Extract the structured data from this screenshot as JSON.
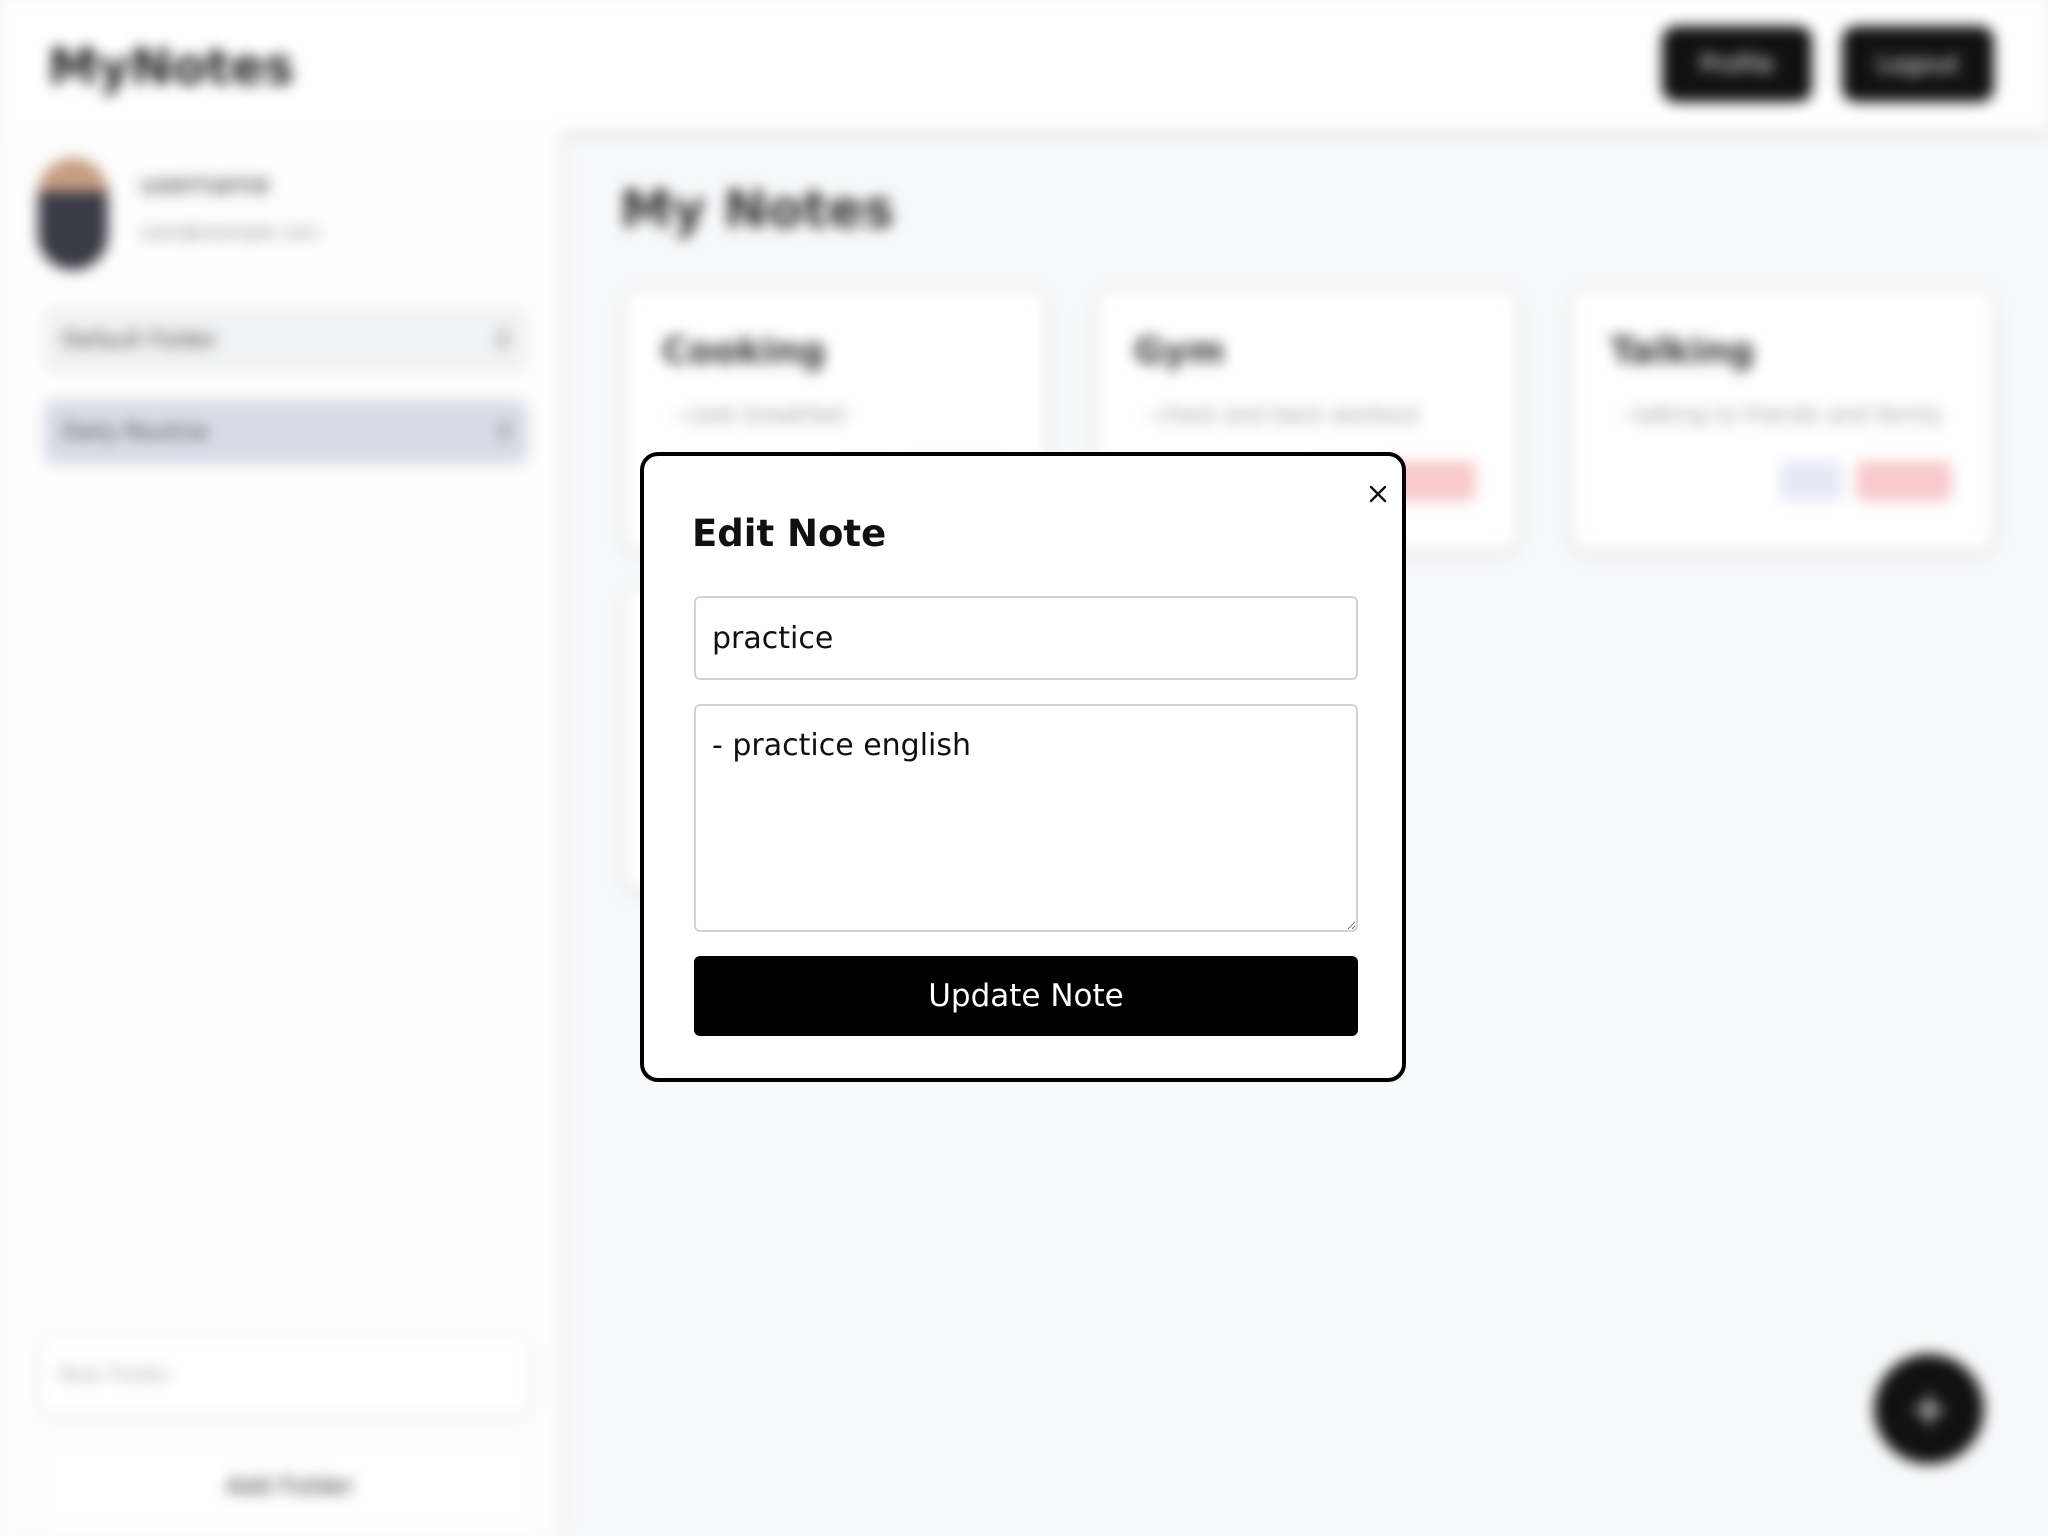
{
  "app": {
    "brand": "MyNotes",
    "header_buttons": [
      "Profile",
      "Logout"
    ]
  },
  "sidebar": {
    "profile_name": "username",
    "profile_email": "user@example.com",
    "items": [
      {
        "label": "Default Folder",
        "count": "2"
      },
      {
        "label": "Daily Routine",
        "count": "3"
      }
    ],
    "new_folder_placeholder": "New Folder",
    "add_folder_label": "Add Folder"
  },
  "main": {
    "title": "My Notes",
    "cards": [
      {
        "title": "Cooking",
        "body": "- cook breakfast"
      },
      {
        "title": "Gym",
        "body": "- chest and back workout"
      },
      {
        "title": "Talking",
        "body": "- talking to friends and family"
      },
      {
        "title": "",
        "body": ""
      }
    ],
    "fab_label": "+"
  },
  "modal": {
    "title": "Edit Note",
    "title_value": "practice",
    "content_value": "- practice english",
    "submit_label": "Update Note",
    "close_icon": "close-icon"
  }
}
